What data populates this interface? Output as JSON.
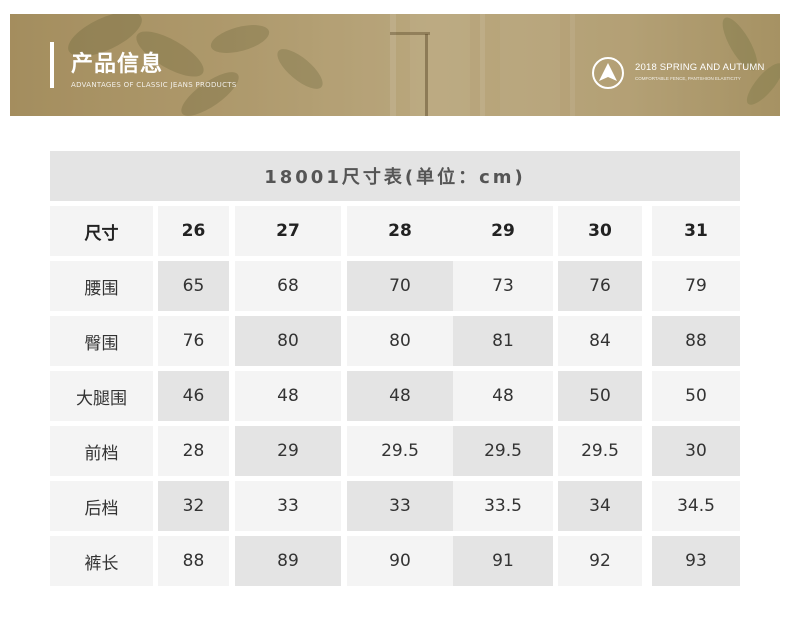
{
  "banner": {
    "title": "产品信息",
    "subtitle": "ADVANTAGES OF CLASSIC JEANS PRODUCTS",
    "brand_line1": "2018  SPRING AND AUTUMN",
    "brand_line2": "COMFORTABLE FENCE, PANTSHION ELASTICITY",
    "logo_icon": "triangle-circle-logo-icon"
  },
  "table": {
    "title": "18001尺寸表(单位：cm)",
    "header_label": "尺寸",
    "sizes": [
      "26",
      "27",
      "28",
      "29",
      "30",
      "31"
    ],
    "rows": [
      {
        "label": "腰围",
        "values": [
          "65",
          "68",
          "70",
          "73",
          "76",
          "79"
        ]
      },
      {
        "label": "臀围",
        "values": [
          "76",
          "80",
          "80",
          "81",
          "84",
          "88"
        ]
      },
      {
        "label": "大腿围",
        "values": [
          "46",
          "48",
          "48",
          "48",
          "50",
          "50"
        ]
      },
      {
        "label": "前档",
        "values": [
          "28",
          "29",
          "29.5",
          "29.5",
          "29.5",
          "30"
        ]
      },
      {
        "label": "后档",
        "values": [
          "32",
          "33",
          "33",
          "33.5",
          "34",
          "34.5"
        ]
      },
      {
        "label": "裤长",
        "values": [
          "88",
          "89",
          "90",
          "91",
          "92",
          "93"
        ]
      }
    ]
  },
  "colors": {
    "banner_tone": "#b8a57a",
    "cell_light": "#f4f4f4",
    "cell_dark": "#e4e4e4"
  }
}
